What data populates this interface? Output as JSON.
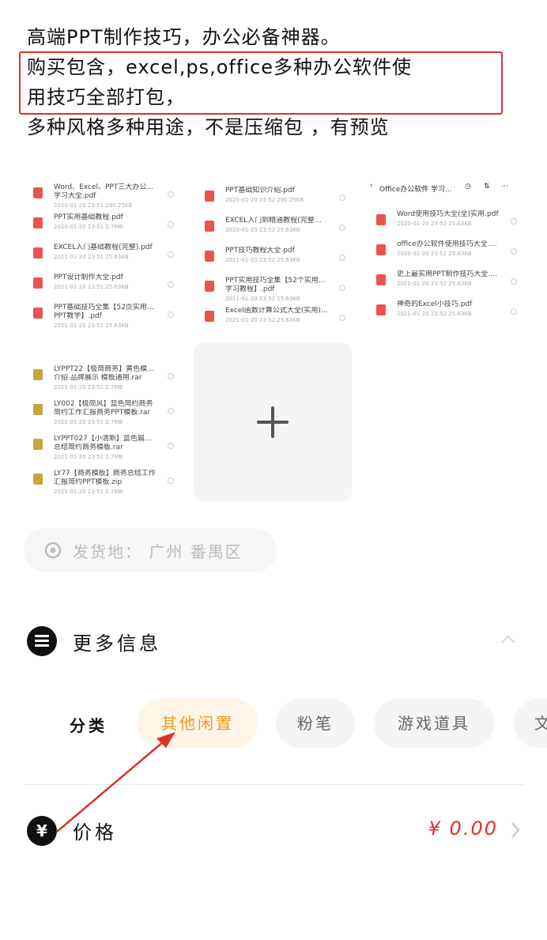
{
  "description": {
    "line1": "高端PPT制作技巧，办公必备神器。",
    "line2": "购买包含，excel,ps,office多种办公软件使",
    "line3": "用技巧全部打包，",
    "line4": "多种风格多种用途，不是压缩包 ，有预览"
  },
  "gallery": {
    "thumb1_files": [
      {
        "name": "Word、Excel、PPT三大办公软件技能",
        "name2": "学习大全.pdf",
        "meta": "2020-01-20 23:51  290.25KB"
      },
      {
        "name": "PPT实用基础教程.pdf",
        "name2": "",
        "meta": "2020-01-20 23:51  2.7MB"
      },
      {
        "name": "EXCEL入门基础教程(完整).pdf",
        "name2": "",
        "meta": "2021-01-20 23:51  25.63KB"
      },
      {
        "name": "PPT设计制作大全.pdf",
        "name2": "",
        "meta": "2021-01-20 23:51  25.63KB"
      },
      {
        "name": "PPT基础技巧全集【52页实用资源",
        "name2": "PPT教学】.pdf",
        "meta": "2021-01-20 23:51  25.63KB"
      }
    ],
    "thumb1_bottom_files": [
      {
        "name": "LYPPT22【极简商务】黄色模板广告",
        "name2": "介绍 品牌展示 模板通用.rar",
        "meta": "2021-01-20 23:51  2.7MB"
      },
      {
        "name": "LY002【极简风】蓝色简约商务",
        "name2": "简约工作汇报商务PPT模板.rar",
        "meta": "2021-01-20 23:51  2.7MB"
      },
      {
        "name": "LYPPT027【小清新】蓝色扁平化",
        "name2": "总结简约商务模板.rar",
        "meta": "2021-01-20 23:51  2.7MB"
      },
      {
        "name": "LY77【商务模板】商务总结工作",
        "name2": "汇报简约PPT模板.zip",
        "meta": "2021-01-20 23:51  2.7MB"
      }
    ],
    "thumb2_files": [
      {
        "name": "PPT基础知识介绍.pdf",
        "name2": "",
        "meta": "2020-01-20 23:52  290.25KB"
      },
      {
        "name": "EXCEL入门到精通教程(完整版).pdf",
        "name2": "",
        "meta": "2020-01-20 23:52  25.63KB"
      },
      {
        "name": "PPT技巧教程大全.pdf",
        "name2": "",
        "meta": "2021-01-20 23:52  25.63KB"
      },
      {
        "name": "PPT实用技巧全集【52个实用小技巧",
        "name2": "学习教程】.pdf",
        "meta": "2021-01-20 23:52  25.63KB"
      },
      {
        "name": "Excel函数计算公式大全(实用).pdf",
        "name2": "",
        "meta": "2021-01-20 23:52  25.63KB"
      }
    ],
    "thumb3_title": "Office办公软件 学习...",
    "thumb3_files": [
      {
        "name": "Word使用技巧大全(全)实用.pdf",
        "name2": "",
        "meta": "2020-01-20 23:52  25.63KB"
      },
      {
        "name": "office办公软件使用技巧大全.pdf",
        "name2": "",
        "meta": "2020-01-20 23:52  25.63KB"
      },
      {
        "name": "史上最实用PPT制作技巧大全.pdf",
        "name2": "",
        "meta": "2021-01-20 23:52  25.63KB"
      },
      {
        "name": "神奇的Excel小技巧.pdf",
        "name2": "",
        "meta": "2021-01-20 23:52  25.63KB"
      }
    ]
  },
  "location": {
    "label": "发货地：",
    "value": "广州 番禺区"
  },
  "more_info": {
    "label": "更多信息"
  },
  "category": {
    "label": "分类",
    "chips": [
      "其他闲置",
      "粉笔",
      "游戏道具",
      "文"
    ],
    "selected_color": "#f09a1e"
  },
  "price": {
    "label": "价格",
    "value": "¥ 0.00",
    "icon": "¥",
    "value_color": "#e0302f"
  },
  "annotation_color": "#d9342b"
}
